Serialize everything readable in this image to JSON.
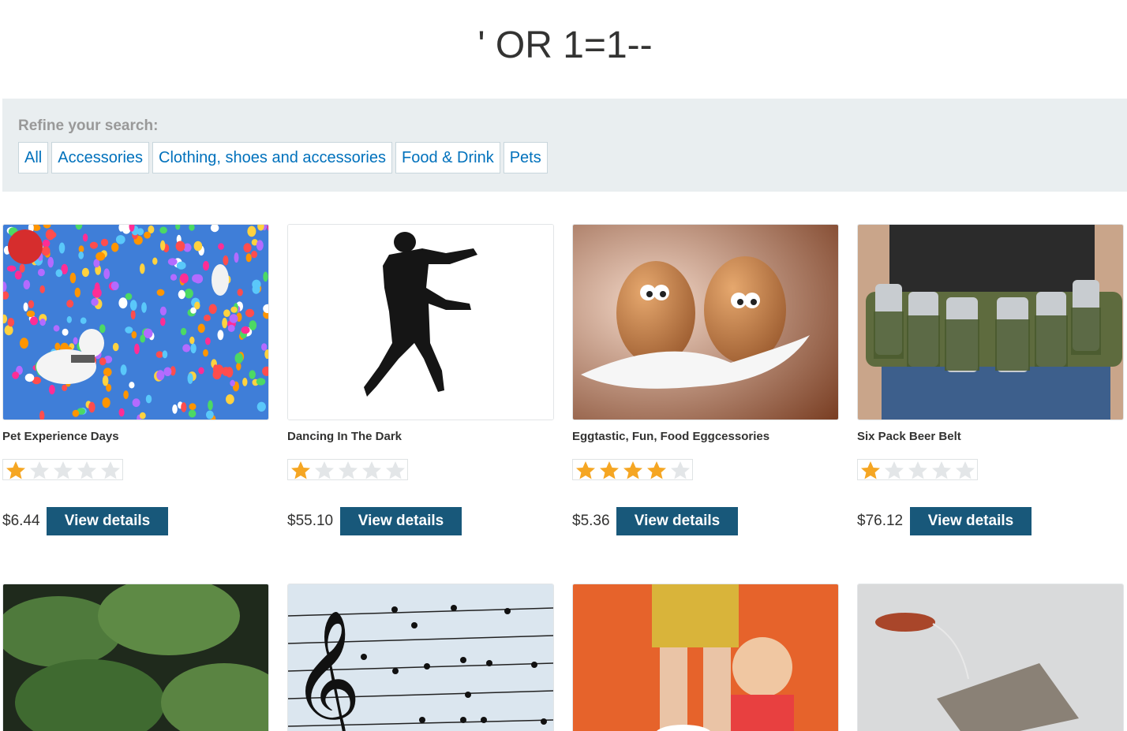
{
  "page": {
    "title": "' OR 1=1--"
  },
  "filters": {
    "label": "Refine your search:",
    "items": [
      "All",
      "Accessories",
      "Clothing, shoes and accessories",
      "Food & Drink",
      "Pets"
    ]
  },
  "view_details_label": "View details",
  "colors": {
    "button": "#18587a",
    "link": "#0071bc",
    "filter_bg": "#e9eef0",
    "star": "#f5a623"
  },
  "products": [
    {
      "name": "Pet Experience Days",
      "price": "$6.44",
      "rating": 1,
      "image": "balloons-dog-image"
    },
    {
      "name": "Dancing In The Dark",
      "price": "$55.10",
      "rating": 1,
      "image": "dancer-silhouette-image"
    },
    {
      "name": "Eggtastic, Fun, Food Eggcessories",
      "price": "$5.36",
      "rating": 4,
      "image": "eggs-image"
    },
    {
      "name": "Six Pack Beer Belt",
      "price": "$76.12",
      "rating": 1,
      "image": "beer-belt-image"
    },
    {
      "name": "",
      "price": "",
      "rating": null,
      "image": "leaves-image"
    },
    {
      "name": "",
      "price": "",
      "rating": null,
      "image": "music-birds-image"
    },
    {
      "name": "",
      "price": "",
      "rating": null,
      "image": "toy-figures-image"
    },
    {
      "name": "",
      "price": "",
      "rating": null,
      "image": "teabag-image"
    }
  ]
}
